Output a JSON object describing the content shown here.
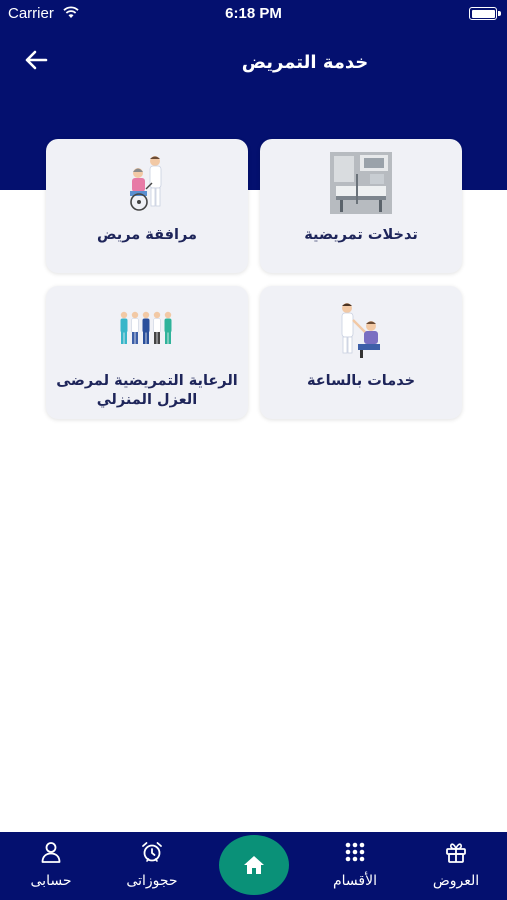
{
  "status_bar": {
    "carrier": "Carrier",
    "time": "6:18 PM"
  },
  "header": {
    "title": "خدمة التمريض",
    "back_icon": "arrow-left-icon"
  },
  "colors": {
    "primary": "#04106f",
    "accent": "#0a9178",
    "card_bg": "#f0f1f6",
    "card_text": "#1e255a"
  },
  "services": [
    {
      "label": "تدخلات تمريضية",
      "icon": "nursing-interventions-image"
    },
    {
      "label": "مرافقة مريض",
      "icon": "patient-companion-image"
    },
    {
      "label": "خدمات بالساعة",
      "icon": "hourly-services-image"
    },
    {
      "label": "الرعاية التمريضية لمرضى العزل المنزلي",
      "icon": "home-isolation-care-image"
    }
  ],
  "bottom_nav": {
    "items": [
      {
        "label": "العروض",
        "icon": "gift-icon"
      },
      {
        "label": "الأقسام",
        "icon": "grid-icon"
      },
      {
        "label": "حجوزاتى",
        "icon": "alarm-clock-icon"
      },
      {
        "label": "حسابى",
        "icon": "user-icon"
      }
    ],
    "home_icon": "home-icon"
  }
}
